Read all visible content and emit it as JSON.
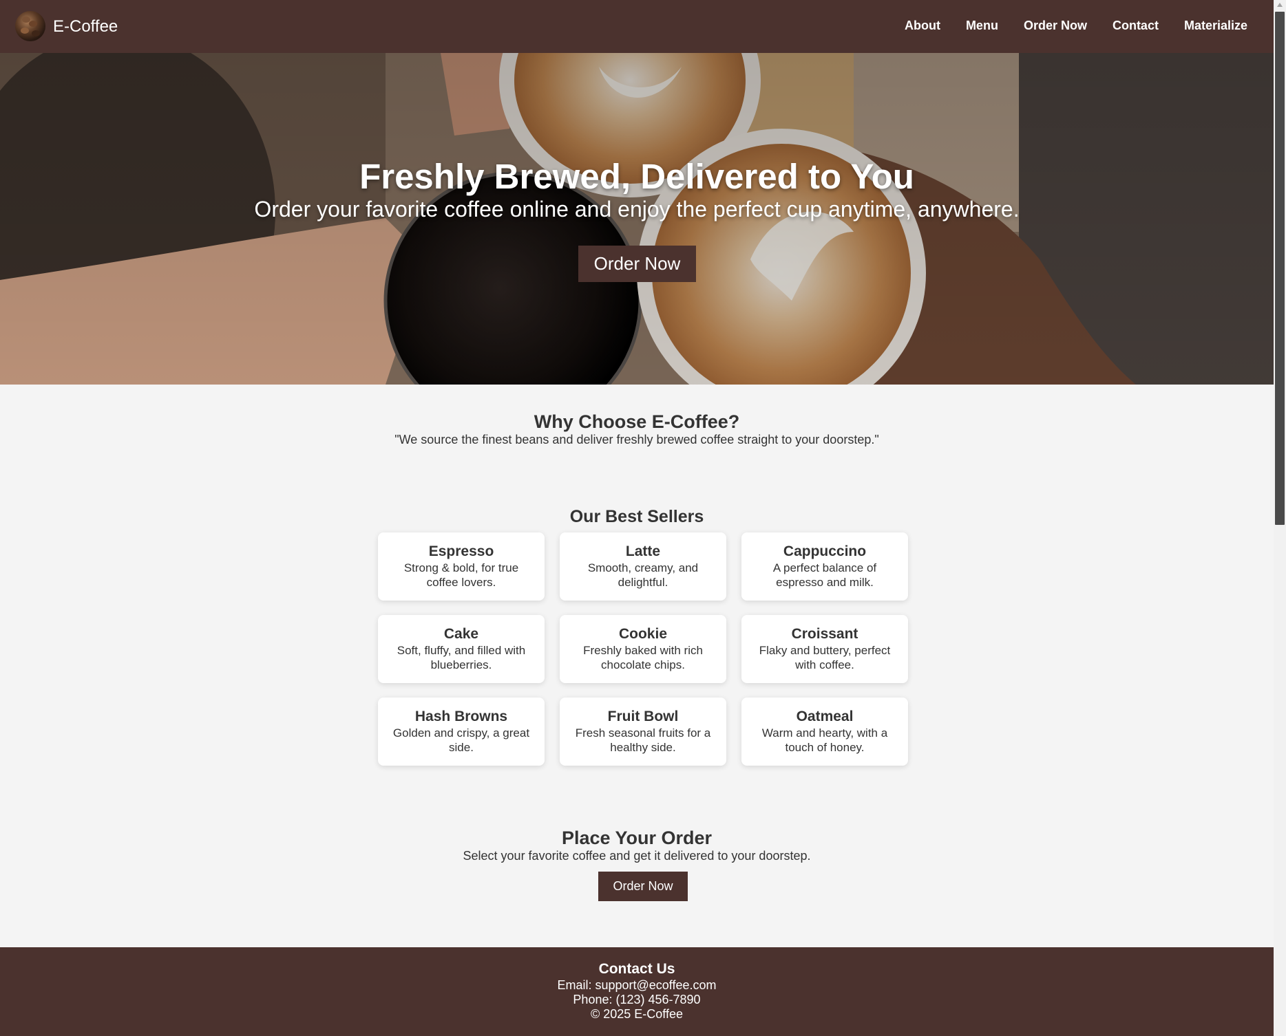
{
  "nav": {
    "brand": "E-Coffee",
    "links": [
      "About",
      "Menu",
      "Order Now",
      "Contact",
      "Materialize"
    ]
  },
  "hero": {
    "title": "Freshly Brewed, Delivered to You",
    "subtitle": "Order your favorite coffee online and enjoy the perfect cup anytime, anywhere.",
    "button": "Order Now"
  },
  "why": {
    "title": "Why Choose E-Coffee?",
    "text": "\"We source the finest beans and deliver freshly brewed coffee straight to your doorstep.\""
  },
  "bestsellers": {
    "title": "Our Best Sellers",
    "items": [
      {
        "name": "Espresso",
        "desc": "Strong & bold, for true coffee lovers."
      },
      {
        "name": "Latte",
        "desc": "Smooth, creamy, and delightful."
      },
      {
        "name": "Cappuccino",
        "desc": "A perfect balance of espresso and milk."
      },
      {
        "name": "Cake",
        "desc": "Soft, fluffy, and filled with blueberries."
      },
      {
        "name": "Cookie",
        "desc": "Freshly baked with rich chocolate chips."
      },
      {
        "name": "Croissant",
        "desc": "Flaky and buttery, perfect with coffee."
      },
      {
        "name": "Hash Browns",
        "desc": "Golden and crispy, a great side."
      },
      {
        "name": "Fruit Bowl",
        "desc": "Fresh seasonal fruits for a healthy side."
      },
      {
        "name": "Oatmeal",
        "desc": "Warm and hearty, with a touch of honey."
      }
    ]
  },
  "order": {
    "title": "Place Your Order",
    "text": "Select your favorite coffee and get it delivered to your doorstep.",
    "button": "Order Now"
  },
  "footer": {
    "title": "Contact Us",
    "email": "Email: support@ecoffee.com",
    "phone": "Phone: (123) 456-7890",
    "copyright": "© 2025 E-Coffee"
  },
  "colors": {
    "brand_brown": "#4b322e",
    "background": "#f4f4f4",
    "text": "#333333"
  }
}
